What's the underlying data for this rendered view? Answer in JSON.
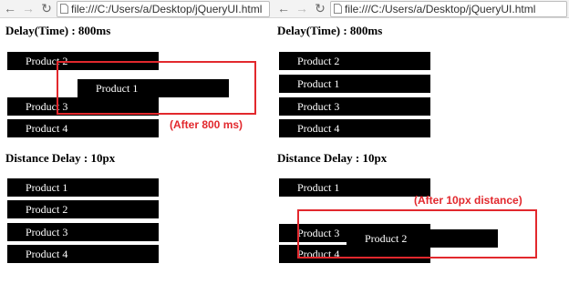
{
  "browser": {
    "url": "file:///C:/Users/a/Desktop/jQueryUI.html",
    "back_glyph": "←",
    "forward_glyph": "→",
    "reload_glyph": "↻"
  },
  "sections": {
    "delay_title": "Delay(Time) : 800ms",
    "distance_title": "Distance Delay : 10px"
  },
  "left": {
    "delay_items": [
      "Product 2",
      "Product 1",
      "Product 3",
      "Product 4"
    ],
    "distance_items": [
      "Product 1",
      "Product 2",
      "Product 3",
      "Product 4"
    ],
    "delay_note": "(After 800 ms)"
  },
  "right": {
    "delay_items": [
      "Product 2",
      "Product 1",
      "Product 3",
      "Product 4"
    ],
    "distance_items": [
      "Product 1",
      "Product 3",
      "Product 2",
      "Product 4"
    ],
    "distance_note": "(After 10px distance)"
  },
  "colors": {
    "callout": "#e2282d",
    "item_bg": "#000000",
    "item_text": "#ffffff"
  }
}
